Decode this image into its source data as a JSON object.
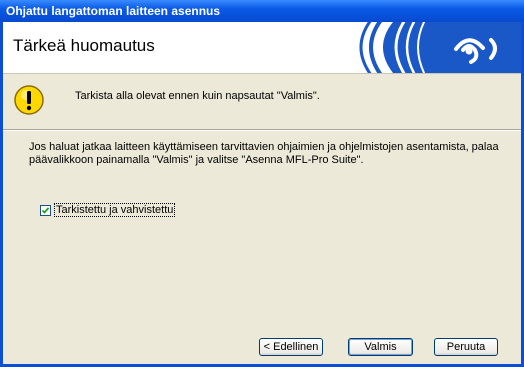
{
  "window": {
    "title": "Ohjattu langattoman laitteen asennus"
  },
  "header": {
    "title": "Tärkeä huomautus",
    "logo_icon": "wireless-signal-icon"
  },
  "notice": {
    "icon": "warning-exclamation-icon",
    "text": "Tarkista alla olevat ennen kuin napsautat \"Valmis\"."
  },
  "body": {
    "paragraph": "Jos haluat jatkaa laitteen käyttämiseen tarvittavien ohjaimien ja ohjelmistojen asentamista, palaa päävalikkoon painamalla \"Valmis\" ja valitse \"Asenna MFL-Pro Suite\"."
  },
  "checkbox": {
    "label": "Tarkistettu ja vahvistettu",
    "checked": true
  },
  "buttons": {
    "back": "< Edellinen",
    "finish": "Valmis",
    "cancel": "Peruuta"
  },
  "colors": {
    "titlebar": "#0a5ae6",
    "logo_blue": "#1a57c7",
    "dialog_bg": "#ece9d8",
    "warning_yellow": "#ffd800"
  }
}
